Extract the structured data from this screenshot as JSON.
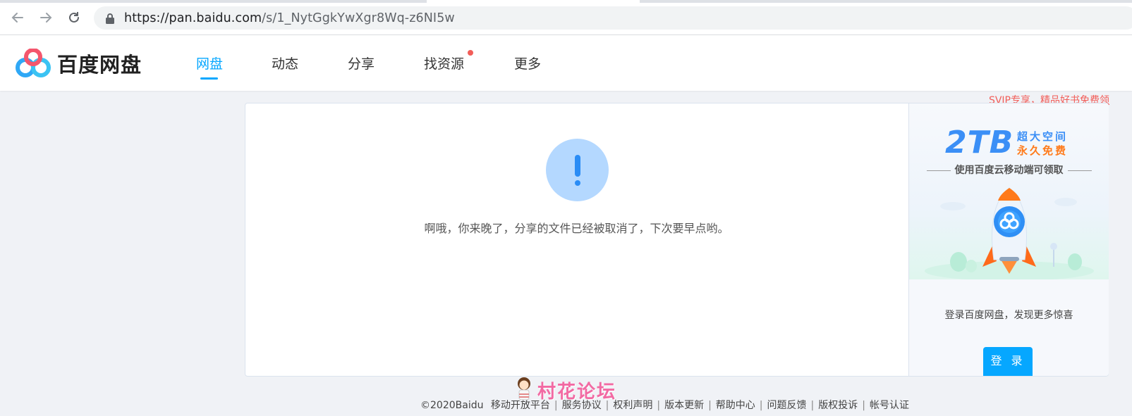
{
  "browser": {
    "url_host": "https://pan.baidu.com",
    "url_path": "/s/1_NytGgkYwXgr8Wq-z6NI5w",
    "back_icon": "arrow-left-icon",
    "forward_icon": "arrow-right-icon",
    "reload_icon": "reload-icon",
    "lock_icon": "lock-icon"
  },
  "header": {
    "brand": "百度网盘",
    "nav": [
      {
        "label": "网盘",
        "active": true
      },
      {
        "label": "动态",
        "active": false
      },
      {
        "label": "分享",
        "active": false
      },
      {
        "label": "找资源",
        "active": false,
        "badge_dot": true
      },
      {
        "label": "更多",
        "active": false
      }
    ],
    "svip_link": "SVIP专享，精品好书免费领"
  },
  "main": {
    "message": "啊哦，你来晚了，分享的文件已经被取消了，下次要早点哟。",
    "status_icon": "exclamation-icon"
  },
  "sidebar": {
    "promo_big": "2TB",
    "promo_line1": "超大空间",
    "promo_line2": "永久免费",
    "promo_sub": "使用百度云移动端可领取",
    "login_prompt": "登录百度网盘，发现更多惊喜",
    "login_button": "登 录"
  },
  "footer": {
    "copyright": "©2020Baidu",
    "links": [
      "移动开放平台",
      "服务协议",
      "权利声明",
      "版本更新",
      "帮助中心",
      "问题反馈",
      "版权投诉",
      "帐号认证"
    ]
  },
  "watermark": {
    "text": "村花论坛"
  },
  "colors": {
    "accent": "#06a7ff",
    "svip": "#f25d58",
    "warn_bg": "#b4d8ff",
    "warn_fg": "#2a8cf5"
  }
}
